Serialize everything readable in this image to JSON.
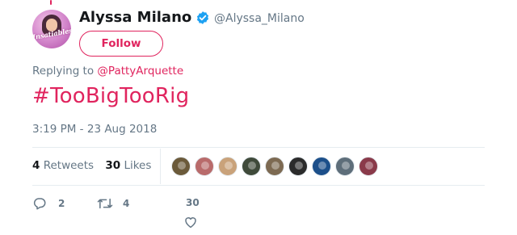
{
  "author": {
    "display_name": "Alyssa Milano",
    "username": "@Alyssa_Milano",
    "avatar_text": "Insatiables",
    "verified": true
  },
  "follow_button": {
    "label": "Follow"
  },
  "reply_context": {
    "prefix": "Replying to",
    "mention": "@PattyArquette"
  },
  "tweet": {
    "text": "#TooBigTooRig",
    "timestamp": "3:19 PM - 23 Aug 2018"
  },
  "stats": {
    "retweets_count": "4",
    "retweets_label": "Retweets",
    "likes_count": "30",
    "likes_label": "Likes"
  },
  "likers": [
    {
      "color": "#6b5a3a"
    },
    {
      "color": "#b96b6b"
    },
    {
      "color": "#c9a27a"
    },
    {
      "color": "#3f4a3a"
    },
    {
      "color": "#7d6a52"
    },
    {
      "color": "#2b2b2b"
    },
    {
      "color": "#1c4f8a"
    },
    {
      "color": "#5e6e7a"
    },
    {
      "color": "#8a3a4a"
    }
  ],
  "actions": {
    "reply_count": "2",
    "retweet_count": "4",
    "like_count": "30"
  },
  "colors": {
    "accent": "#e0245e",
    "muted": "#657786",
    "verified": "#1da1f2",
    "border": "#e6ecf0"
  }
}
